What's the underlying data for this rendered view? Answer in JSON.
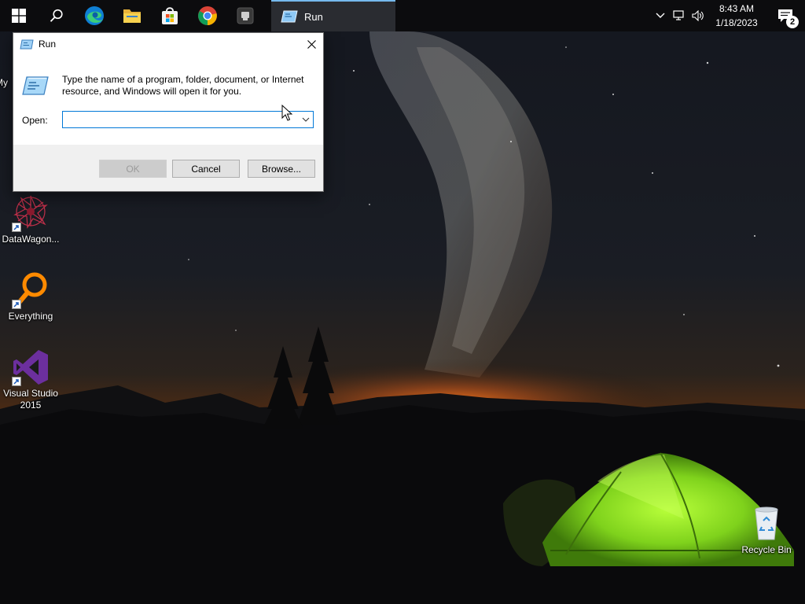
{
  "taskbar": {
    "pinned": [
      {
        "name": "start"
      },
      {
        "name": "search"
      },
      {
        "name": "edge"
      },
      {
        "name": "file-explorer"
      },
      {
        "name": "microsoft-store"
      },
      {
        "name": "chrome"
      },
      {
        "name": "app"
      }
    ],
    "active_window_label": "Run",
    "tray": {
      "time": "8:43 AM",
      "date": "1/18/2023",
      "notification_count": "2"
    }
  },
  "desktop": {
    "icons": [
      {
        "label": "My",
        "partial": true
      },
      {
        "label": "DataWagon..."
      },
      {
        "label": "Everything"
      },
      {
        "label": "Visual Studio 2015"
      },
      {
        "label": "Recycle Bin"
      }
    ]
  },
  "run_dialog": {
    "title": "Run",
    "description": "Type the name of a program, folder, document, or Internet resource, and Windows will open it for you.",
    "open_label": "Open:",
    "open_value": "",
    "buttons": {
      "ok": "OK",
      "cancel": "Cancel",
      "browse": "Browse..."
    }
  },
  "colors": {
    "taskbar": "#0c0c0e",
    "accent": "#0078d7",
    "active_underline": "#76b9ed"
  }
}
